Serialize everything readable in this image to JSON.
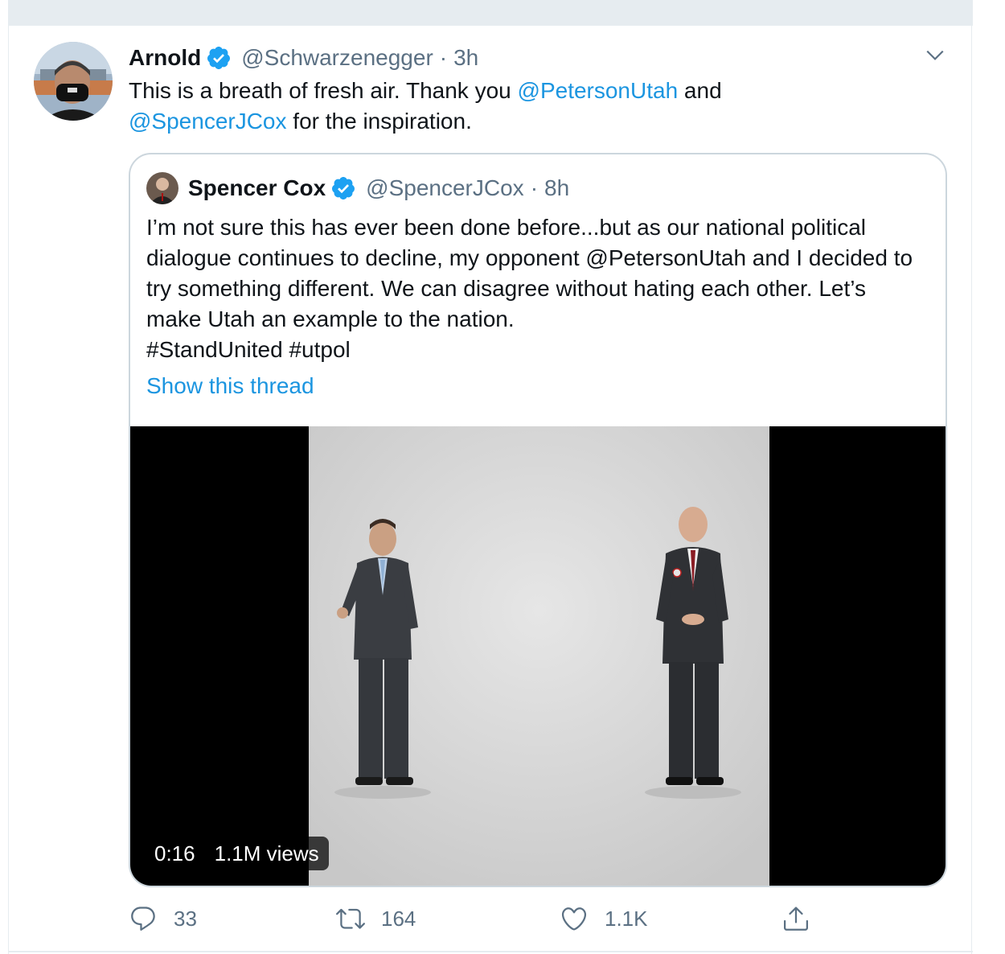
{
  "tweet": {
    "author_name": "Arnold",
    "handle": "@Schwarzenegger",
    "separator": "·",
    "time": "3h",
    "text_before": "This is a breath of fresh air. Thank you ",
    "mention_1": "@PetersonUtah",
    "text_middle": " and",
    "mention_2": "@SpencerJCox",
    "text_after": " for the inspiration."
  },
  "quoted": {
    "author_name": "Spencer Cox",
    "handle": "@SpencerJCox",
    "separator": "·",
    "time": "8h",
    "text_part1": "I’m not sure this has ever been done before...but as our national political dialogue continues to decline, my opponent ",
    "mention": "@PetersonUtah",
    "text_part2": " and I decided to try something different. We can disagree without hating each other. Let’s make Utah an example to the nation.",
    "hashtag_1": "#StandUnited",
    "hashtag_2": "#utpol",
    "show_thread": "Show this thread",
    "video": {
      "duration": "0:16",
      "views": "1.1M views"
    }
  },
  "actions": {
    "reply_count": "33",
    "retweet_count": "164",
    "like_count": "1.1K"
  },
  "colors": {
    "link": "#1b95e0",
    "verified": "#1da1f2",
    "secondary_text": "#5b7083",
    "border": "#ccd6dd"
  },
  "icons": [
    "verified-badge-icon",
    "chevron-down-icon",
    "reply-icon",
    "retweet-icon",
    "like-icon",
    "share-icon"
  ]
}
